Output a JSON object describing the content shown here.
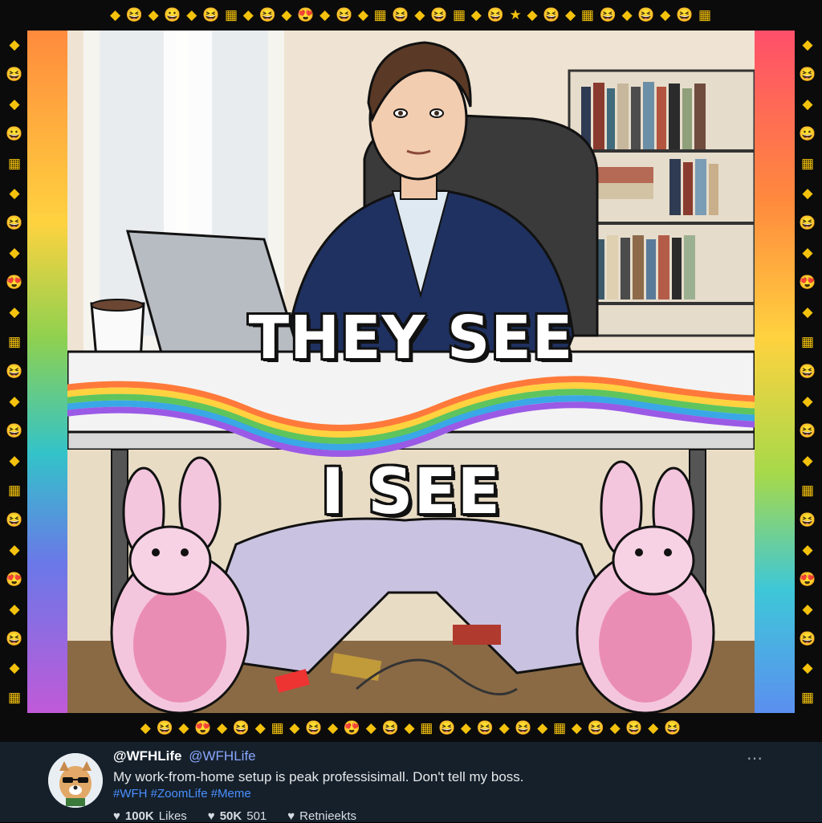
{
  "border": {
    "top_row": "◆ 😆 ◆ 😀 ◆ 😆 ▦ ◆ 😆 ◆ 😍 ◆ 😆 ◆ ▦ 😆 ◆ 😆 ▦ ◆ 😆 ★ ◆ 😆 ◆ ▦ 😆 ◆ 😆 ◆ 😆 ▦",
    "bottom_row": "◆ 😆 ◆ 😍 ◆ 😆 ◆ ▦ ◆ 😆 ◆ 😍 ◆ 😆 ◆ ▦ 😆 ◆ 😆 ◆ 😆 ◆ ▦ ◆ 😆 ◆ 😆 ◆ 😆",
    "left_col": [
      "◆",
      "😆",
      "◆",
      "😀",
      "▦",
      "◆",
      "😆",
      "◆",
      "😍",
      "◆",
      "▦",
      "😆",
      "◆",
      "😆",
      "◆",
      "▦",
      "😆",
      "◆",
      "😍",
      "◆",
      "😆",
      "◆",
      "▦"
    ],
    "right_col": [
      "◆",
      "😆",
      "◆",
      "😀",
      "▦",
      "◆",
      "😆",
      "◆",
      "😍",
      "◆",
      "▦",
      "😆",
      "◆",
      "😆",
      "◆",
      "▦",
      "😆",
      "◆",
      "😍",
      "◆",
      "😆",
      "◆",
      "▦"
    ]
  },
  "meme": {
    "top_caption": "THEY SEE",
    "bottom_caption": "I SEE"
  },
  "tweet": {
    "display_name": "@WFHLife",
    "handle": "@WFHLife",
    "text": "My work-from-home setup is peak professisimall. Don't tell my boss.",
    "hashtags": "#WFH #ZoomLife #Meme",
    "more_icon": "⋯",
    "actions": [
      {
        "icon": "heart-icon",
        "glyph": "♥",
        "count": "100K",
        "label": "Likes"
      },
      {
        "icon": "heart-icon",
        "glyph": "♥",
        "count": "50K",
        "label": "501"
      },
      {
        "icon": "heart-icon",
        "glyph": "♥",
        "count": "",
        "label": "Retnieekts"
      }
    ]
  },
  "colors": {
    "tweet_bg": "#15202b",
    "hashtag": "#4a90ff",
    "caption_fill": "#ffffff"
  }
}
